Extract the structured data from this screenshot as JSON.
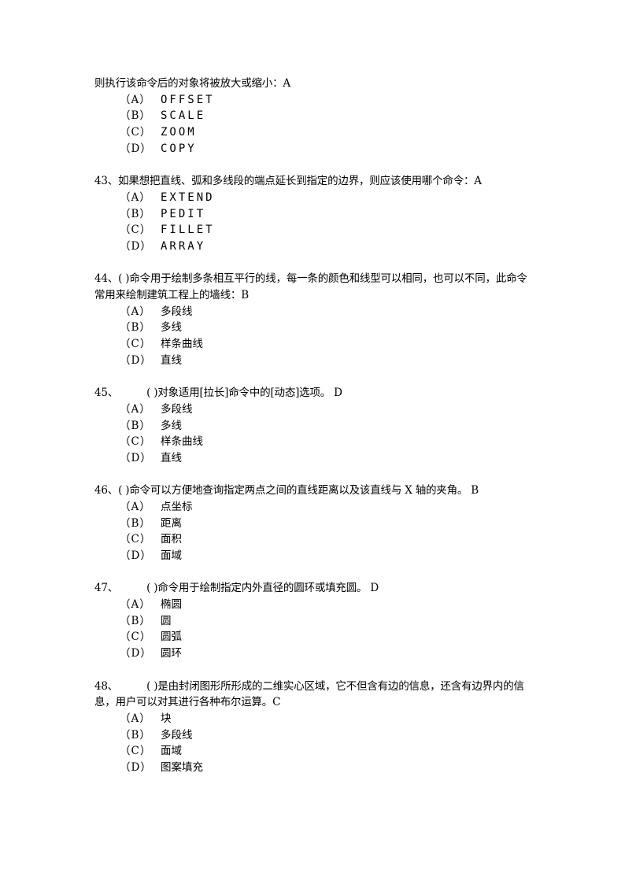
{
  "questions": [
    {
      "number": "",
      "text": "则执行该命令后的对象将被放大或缩小：A",
      "latin_options": true,
      "options": [
        {
          "label": "（A）",
          "text": "OFFSET"
        },
        {
          "label": "（B）",
          "text": "SCALE"
        },
        {
          "label": "（C）",
          "text": "ZOOM"
        },
        {
          "label": "（D）",
          "text": "COPY"
        }
      ]
    },
    {
      "number": "43、",
      "text": "如果想把直线、弧和多线段的端点延长到指定的边界，则应该使用哪个命令：A",
      "latin_options": true,
      "options": [
        {
          "label": "（A）",
          "text": "EXTEND"
        },
        {
          "label": "（B）",
          "text": "PEDIT"
        },
        {
          "label": "（C）",
          "text": "FILLET"
        },
        {
          "label": "（D）",
          "text": "ARRAY"
        }
      ]
    },
    {
      "number": "44、",
      "text": "( )命令用于绘制多条相互平行的线，每一条的颜色和线型可以相同，也可以不同，此命令常用来绘制建筑工程上的墙线：B",
      "latin_options": false,
      "options": [
        {
          "label": "（A）",
          "text": "多段线"
        },
        {
          "label": "（B）",
          "text": "多线"
        },
        {
          "label": "（C）",
          "text": "样条曲线"
        },
        {
          "label": "（D）",
          "text": "直线"
        }
      ]
    },
    {
      "number": "45、",
      "gap": true,
      "text": "( )对象适用[拉长]命令中的[动态]选项。 D",
      "latin_options": false,
      "options": [
        {
          "label": "（A）",
          "text": "多段线"
        },
        {
          "label": "（B）",
          "text": "多线"
        },
        {
          "label": "（C）",
          "text": "样条曲线"
        },
        {
          "label": "（D）",
          "text": "直线"
        }
      ]
    },
    {
      "number": "46、",
      "text": "( )命令可以方便地查询指定两点之间的直线距离以及该直线与 X 轴的夹角。 B",
      "latin_options": false,
      "options": [
        {
          "label": "（A）",
          "text": "点坐标"
        },
        {
          "label": "（B）",
          "text": "距离"
        },
        {
          "label": "（C）",
          "text": "面积"
        },
        {
          "label": "（D）",
          "text": "面域"
        }
      ]
    },
    {
      "number": "47、",
      "gap": true,
      "text": "( )命令用于绘制指定内外直径的圆环或填充圆。 D",
      "latin_options": false,
      "options": [
        {
          "label": "（A）",
          "text": "椭圆"
        },
        {
          "label": "（B）",
          "text": "圆"
        },
        {
          "label": "（C）",
          "text": "圆弧"
        },
        {
          "label": "（D）",
          "text": "圆环"
        }
      ]
    },
    {
      "number": "48、",
      "gap": true,
      "text": "( )是由封闭图形所形成的二维实心区域，它不但含有边的信息，还含有边界内的信息，用户可以对其进行各种布尔运算。C",
      "latin_options": false,
      "options": [
        {
          "label": "（A）",
          "text": "块"
        },
        {
          "label": "（B）",
          "text": "多段线"
        },
        {
          "label": "（C）",
          "text": "面域"
        },
        {
          "label": "（D）",
          "text": "图案填充"
        }
      ]
    }
  ]
}
